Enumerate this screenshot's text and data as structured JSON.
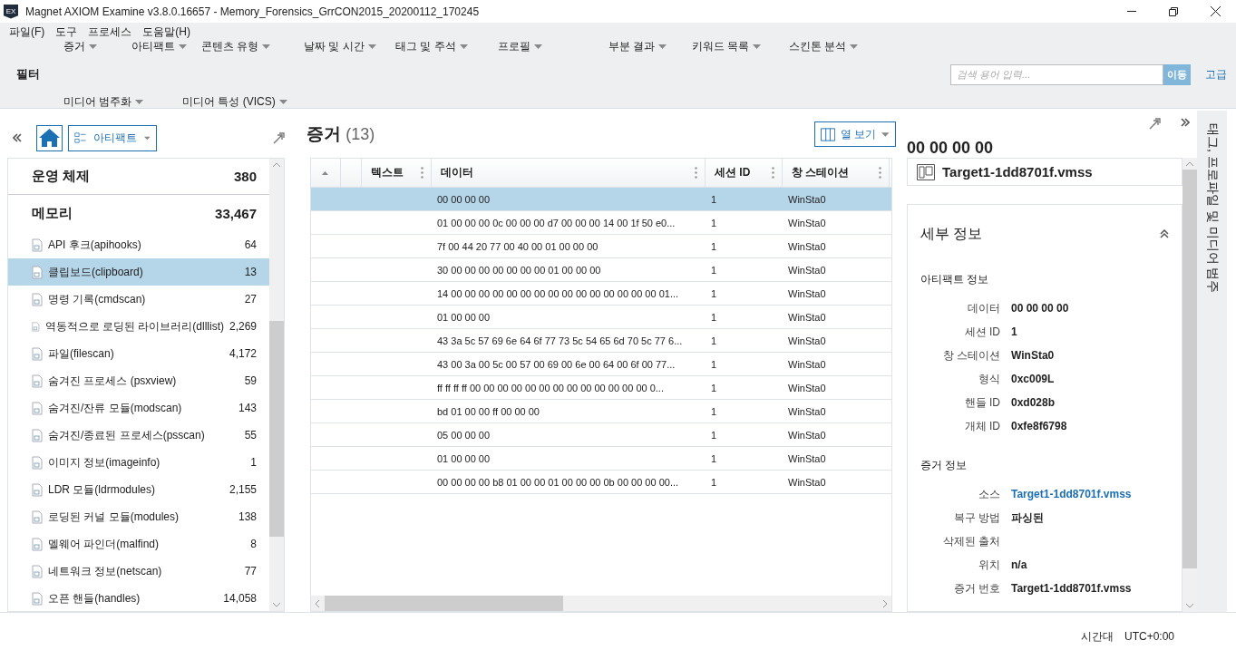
{
  "window": {
    "title": "Magnet AXIOM Examine v3.8.0.16657 - Memory_Forensics_GrrCON2015_20200112_170245",
    "app_badge": "EX"
  },
  "menu": [
    "파일(F)",
    "도구",
    "프로세스",
    "도움말(H)"
  ],
  "filter_bar": {
    "label": "필터",
    "filters": [
      "증거",
      "아티팩트",
      "콘텐츠 유형",
      "날짜 및 시간",
      "태그 및 주석",
      "프로필",
      "부분 결과",
      "키워드 목록",
      "스킨톤 분석",
      "미디어 범주화",
      "미디어 특성 (VICS)"
    ],
    "search": {
      "placeholder": "검색 용어 입력...",
      "go": "이동",
      "advanced": "고급"
    }
  },
  "left_panel": {
    "view": "아티팩트",
    "groups": [
      {
        "name": "운영 체제",
        "count": "380",
        "expanded": false
      },
      {
        "name": "메모리",
        "count": "33,467",
        "expanded": true,
        "children": [
          {
            "name": "API 후크(apihooks)",
            "count": "64",
            "selected": false
          },
          {
            "name": "클립보드(clipboard)",
            "count": "13",
            "selected": true
          },
          {
            "name": "명령 기록(cmdscan)",
            "count": "27",
            "selected": false
          },
          {
            "name": "역동적으로 로딩된 라이브러리(dlllist)",
            "count": "2,269",
            "selected": false
          },
          {
            "name": "파일(filescan)",
            "count": "4,172",
            "selected": false
          },
          {
            "name": "숨겨진 프로세스 (psxview)",
            "count": "59",
            "selected": false
          },
          {
            "name": "숨겨진/잔류 모듈(modscan)",
            "count": "143",
            "selected": false
          },
          {
            "name": "숨겨진/종료된 프로세스(psscan)",
            "count": "55",
            "selected": false
          },
          {
            "name": "이미지 정보(imageinfo)",
            "count": "1",
            "selected": false
          },
          {
            "name": "LDR 모듈(ldrmodules)",
            "count": "2,155",
            "selected": false
          },
          {
            "name": "로딩된 커널 모듈(modules)",
            "count": "138",
            "selected": false
          },
          {
            "name": "멜웨어 파인더(malfind)",
            "count": "8",
            "selected": false
          },
          {
            "name": "네트워크 정보(netscan)",
            "count": "77",
            "selected": false
          },
          {
            "name": "오픈 핸들(handles)",
            "count": "14,058",
            "selected": false
          }
        ]
      }
    ]
  },
  "evidence": {
    "title": "증거",
    "count": "(13)",
    "columns_button": "열 보기",
    "columns": [
      "텍스트",
      "데이터",
      "세션 ID",
      "창 스테이션"
    ],
    "rows": [
      {
        "data": "00 00 00 00",
        "session": "1",
        "station": "WinSta0",
        "selected": true
      },
      {
        "data": "01 00 00 00 0c 00 00 00 d7 00 00 00 14 00 1f 50 e0...",
        "session": "1",
        "station": "WinSta0",
        "selected": false
      },
      {
        "data": "7f 00 44 20 77 00 40 00 01 00 00 00",
        "session": "1",
        "station": "WinSta0",
        "selected": false
      },
      {
        "data": "30 00 00 00 00 00 00 00 01 00 00 00",
        "session": "1",
        "station": "WinSta0",
        "selected": false
      },
      {
        "data": "14 00 00 00 00 00 00 00 00 00 00 00 00 00 00 00 01...",
        "session": "1",
        "station": "WinSta0",
        "selected": false
      },
      {
        "data": "01 00 00 00",
        "session": "1",
        "station": "WinSta0",
        "selected": false
      },
      {
        "data": "43 3a 5c 57 69 6e 64 6f 77 73 5c 54 65 6d 70 5c 77 6...",
        "session": "1",
        "station": "WinSta0",
        "selected": false
      },
      {
        "data": "43 00 3a 00 5c 00 57 00 69 00 6e 00 64 00 6f 00 77...",
        "session": "1",
        "station": "WinSta0",
        "selected": false
      },
      {
        "data": "ff ff ff ff 00 00 00 00 00 00 00 00 00 00 00 00 00 0...",
        "session": "1",
        "station": "WinSta0",
        "selected": false
      },
      {
        "data": "bd 01 00 00 ff 00 00 00",
        "session": "1",
        "station": "WinSta0",
        "selected": false
      },
      {
        "data": "05 00 00 00",
        "session": "1",
        "station": "WinSta0",
        "selected": false
      },
      {
        "data": "01 00 00 00",
        "session": "1",
        "station": "WinSta0",
        "selected": false
      },
      {
        "data": "00 00 00 00 b8 01 00 00 01 00 00 00 0b 00 00 00 00...",
        "session": "1",
        "station": "WinSta0",
        "selected": false
      }
    ]
  },
  "detail_panel": {
    "heading": "00 00 00 00",
    "source": "Target1-1dd8701f.vmss",
    "details_title": "세부 정보",
    "expanded": true,
    "sections": [
      {
        "title": "아티팩트 정보",
        "fields": [
          {
            "label": "데이터",
            "value": "00 00 00 00",
            "kind": "text"
          },
          {
            "label": "세션 ID",
            "value": "1",
            "kind": "text"
          },
          {
            "label": "창 스테이션",
            "value": "WinSta0",
            "kind": "text"
          },
          {
            "label": "형식",
            "value": "0xc009L",
            "kind": "text"
          },
          {
            "label": "핸들 ID",
            "value": "0xd028b",
            "kind": "text"
          },
          {
            "label": "개체 ID",
            "value": "0xfe8f6798",
            "kind": "text"
          }
        ]
      },
      {
        "title": "증거 정보",
        "fields": [
          {
            "label": "소스",
            "value": "Target1-1dd8701f.vmss",
            "kind": "link"
          },
          {
            "label": "복구 방법",
            "value": "파싱된",
            "kind": "text"
          },
          {
            "label": "삭제된 출처"
          },
          {
            "label": "위치",
            "value": "n/a",
            "kind": "text"
          },
          {
            "label": "증거 번호",
            "value": "Target1-1dd8701f.vmss",
            "kind": "text"
          }
        ]
      }
    ]
  },
  "side_tab": "태그, 프로파일 및 미디어 범주",
  "status_bar": {
    "label": "시간대",
    "value": "UTC+0:00"
  }
}
